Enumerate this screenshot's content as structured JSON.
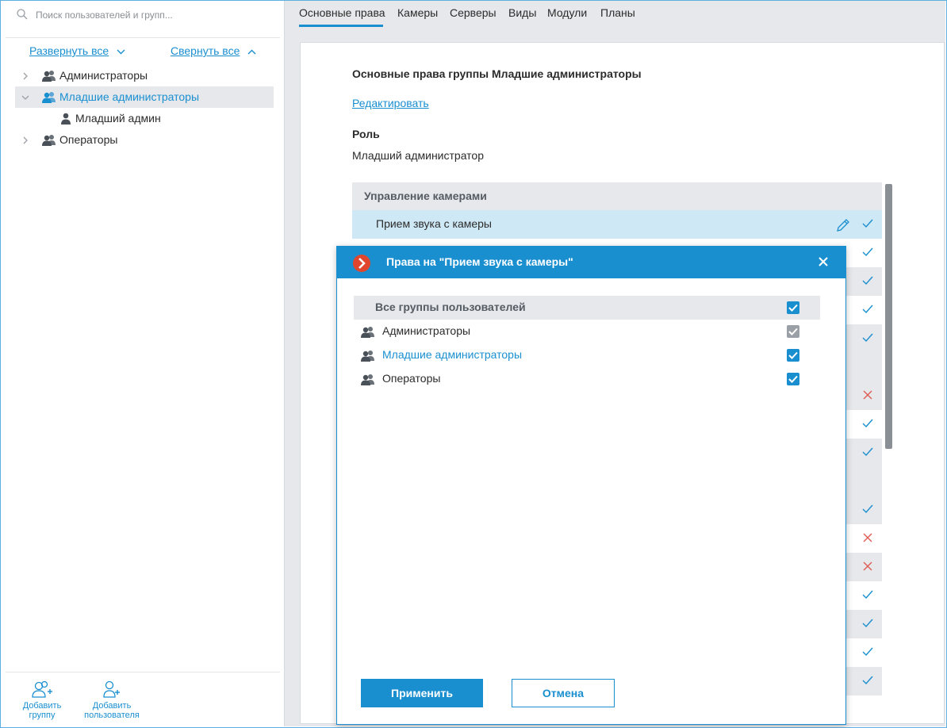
{
  "search": {
    "placeholder": "Поиск пользователей и групп..."
  },
  "tree_controls": {
    "expand_all": "Развернуть все",
    "collapse_all": "Свернуть все"
  },
  "tree": {
    "items": [
      {
        "label": "Администраторы"
      },
      {
        "label": "Младшие администраторы"
      },
      {
        "label": "Младший админ"
      },
      {
        "label": "Операторы"
      }
    ]
  },
  "bottom_bar": {
    "add_group": [
      "Добавить",
      "группу"
    ],
    "add_user": [
      "Добавить",
      "пользователя"
    ]
  },
  "tabs": [
    "Основные права",
    "Камеры",
    "Серверы",
    "Виды",
    "Модули",
    "Планы"
  ],
  "active_tab": "Основные права",
  "content": {
    "title": "Основные права группы Младшие администраторы",
    "edit_link": "Редактировать",
    "role_heading": "Роль",
    "role_value": "Младший администратор",
    "section_header": "Управление камерами",
    "first_row": "Прием звука с камеры"
  },
  "permission_marks": [
    "check",
    "check",
    "check",
    "check",
    "check",
    "header",
    "cross",
    "check",
    "check",
    "header",
    "check",
    "cross",
    "cross",
    "check",
    "check",
    "check",
    "check"
  ],
  "colors": {
    "accent": "#1a8fd0",
    "cross": "#e05a4f",
    "logo": "#e0452d"
  },
  "dialog": {
    "title": "Права на \"Прием звука с камеры\"",
    "all_groups_label": "Все группы пользователей",
    "groups": [
      {
        "label": "Администраторы",
        "checked": true,
        "disabled": true
      },
      {
        "label": "Младшие администраторы",
        "checked": true,
        "disabled": false
      },
      {
        "label": "Операторы",
        "checked": true,
        "disabled": false
      }
    ],
    "apply_label": "Применить",
    "cancel_label": "Отмена"
  }
}
